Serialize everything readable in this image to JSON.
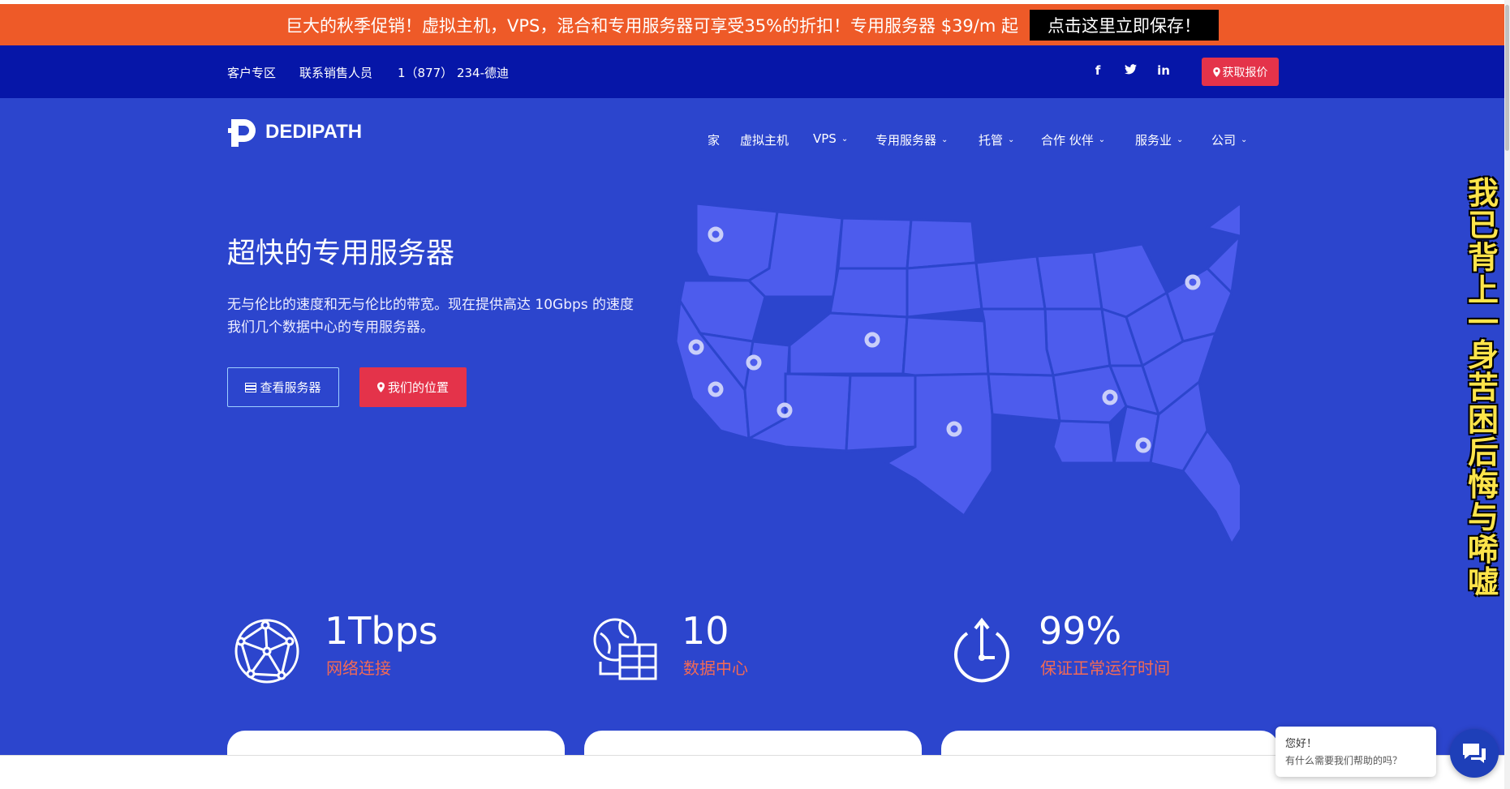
{
  "promo": {
    "text": "巨大的秋季促销！虚拟主机，VPS，混合和专用服务器可享受35%的折扣！专用服务器 $39/m 起",
    "cta": "点击这里立即保存！"
  },
  "topbar": {
    "client_area": "客户专区",
    "contact_sales": "联系销售人员",
    "phone": "1（877） 234-德迪",
    "social": {
      "facebook": "f",
      "twitter": "t",
      "linkedin": "in"
    },
    "quote_button": "获取报价"
  },
  "brand": {
    "name": "DEDIPATH"
  },
  "nav": {
    "items": [
      {
        "label": "家",
        "dropdown": false
      },
      {
        "label": "虚拟主机",
        "dropdown": false
      },
      {
        "label": "VPS",
        "dropdown": true
      },
      {
        "label": "专用服务器",
        "dropdown": true
      },
      {
        "label": "托管",
        "dropdown": true
      },
      {
        "label": "合作 伙伴",
        "dropdown": true
      },
      {
        "label": "服务业",
        "dropdown": true
      },
      {
        "label": "公司",
        "dropdown": true
      }
    ]
  },
  "hero": {
    "title": "超快的专用服务器",
    "desc_line1": "无与伦比的速度和无与伦比的带宽。现在提供高达 10Gbps 的速度",
    "desc_line2": "我们几个数据中心的专用服务器。",
    "btn_servers": "查看服务器",
    "btn_locations": "我们的位置"
  },
  "stats": [
    {
      "value": "1Tbps",
      "label": "网络连接",
      "icon": "globe-network-icon"
    },
    {
      "value": "10",
      "label": "数据中心",
      "icon": "datacenter-icon"
    },
    {
      "value": "99%",
      "label": "保证正常运行时间",
      "icon": "uptime-clock-icon"
    }
  ],
  "overlay": {
    "side_text": "我已背上一身苦困后悔与唏嘘"
  },
  "chat": {
    "greeting": "您好！",
    "prompt": "有什么需要我们帮助的吗？"
  },
  "colors": {
    "promo": "#ee5a28",
    "topbar": "#0616a8",
    "hero": "#2c45cd",
    "map": "#4d5ced",
    "accent_red": "#e4334a",
    "stat_label": "#f36a55"
  }
}
